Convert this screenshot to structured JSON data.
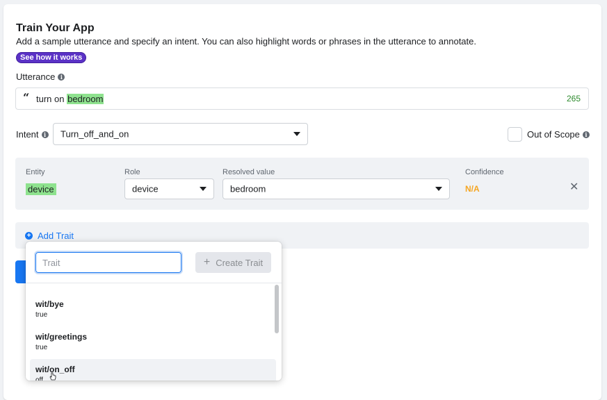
{
  "header": {
    "title": "Train Your App",
    "subtitle": "Add a sample utterance and specify an intent. You can also highlight words or phrases in the utterance to annotate.",
    "help_pill": "See how it works"
  },
  "utterance": {
    "label": "Utterance",
    "text_plain": "turn on ",
    "text_highlight": "bedroom",
    "char_count": "265"
  },
  "intent": {
    "label": "Intent",
    "selected": "Turn_off_and_on"
  },
  "out_of_scope": {
    "label": "Out of Scope",
    "checked": false
  },
  "entity": {
    "col_entity": "Entity",
    "col_role": "Role",
    "col_resolved": "Resolved value",
    "col_confidence": "Confidence",
    "entity_name": "device",
    "role": "device",
    "resolved_value": "bedroom",
    "confidence": "N/A"
  },
  "trait": {
    "add_label": "Add Trait",
    "search_placeholder": "Trait",
    "create_label": "Create Trait",
    "options": [
      {
        "name": "wit/bye",
        "value": "true"
      },
      {
        "name": "wit/greetings",
        "value": "true"
      },
      {
        "name": "wit/on_off",
        "value": "off"
      }
    ]
  },
  "colors": {
    "accent": "#1877f2",
    "pill": "#5b32c6",
    "highlight": "#8ee28e",
    "confidence": "#f5a623",
    "count": "#2e8b2e"
  }
}
